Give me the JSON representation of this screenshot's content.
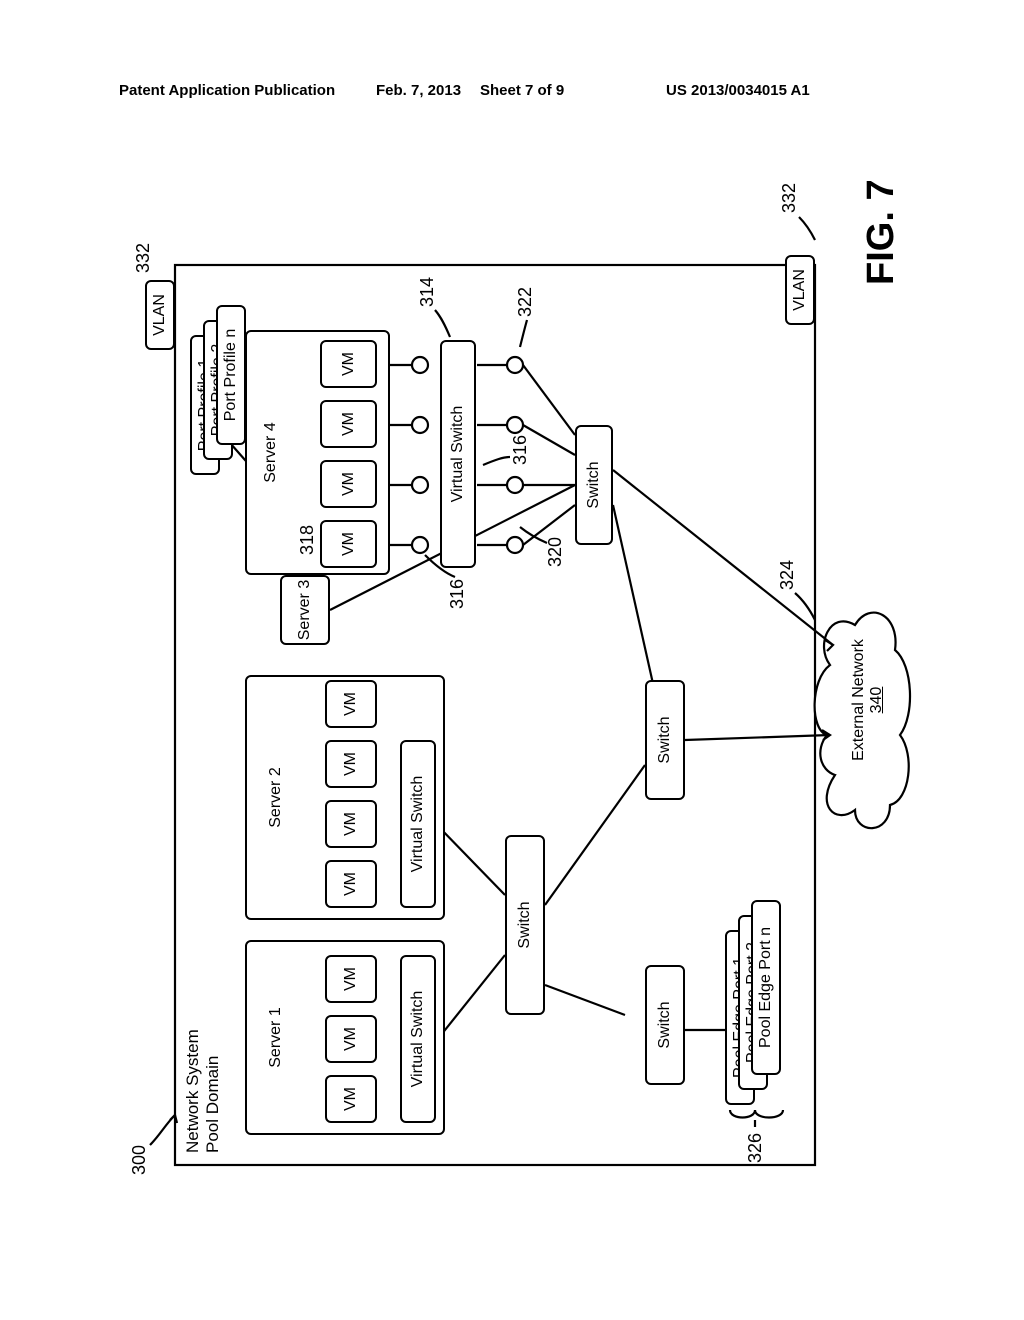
{
  "header": {
    "left": "Patent Application Publication",
    "date": "Feb. 7, 2013",
    "sheet": "Sheet 7 of 9",
    "pubnum": "US 2013/0034015 A1"
  },
  "fig": {
    "title_label": "Network System\nPool Domain",
    "num_300": "300",
    "servers": {
      "s1": "Server 1",
      "s2": "Server 2",
      "s3": "Server 3",
      "s4": "Server 4"
    },
    "vm": "VM",
    "vswitch": "Virtual Switch",
    "switch": "Switch",
    "port_profiles": {
      "p1": "Port Profile 1",
      "p2": "Port Profile 2",
      "pn": "Port Profile n"
    },
    "pool_edge": {
      "e1": "Pool Edge Port 1",
      "e2": "Pool Edge Port 2",
      "en": "Pool Edge Port n"
    },
    "vlan": "VLAN",
    "ext_net": "External Network",
    "ext_net_num": "340",
    "refs": {
      "r332a": "332",
      "r332b": "332",
      "r318": "318",
      "r316a": "316",
      "r316b": "316",
      "r314": "314",
      "r320": "320",
      "r322": "322",
      "r324": "324",
      "r326": "326"
    },
    "figlabel": "FIG. 7"
  }
}
